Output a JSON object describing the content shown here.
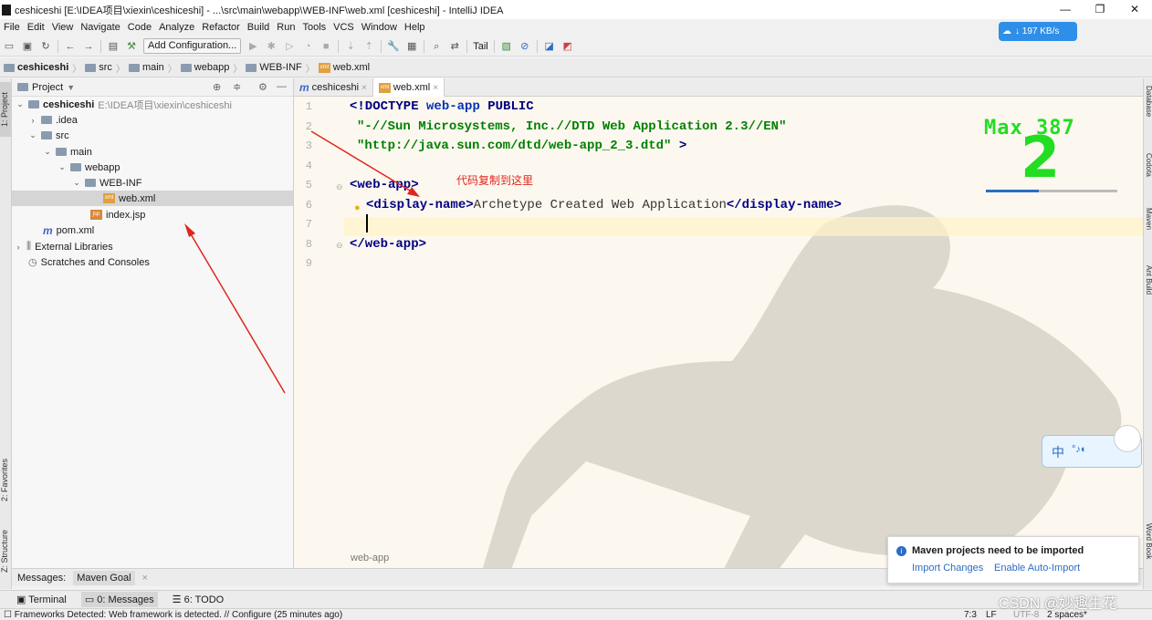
{
  "window": {
    "title": "ceshiceshi [E:\\IDEA项目\\xiexin\\ceshiceshi] - ...\\src\\main\\webapp\\WEB-INF\\web.xml [ceshiceshi] - IntelliJ IDEA",
    "minimize": "—",
    "maximize": "❐",
    "close": "✕"
  },
  "menu": [
    "File",
    "Edit",
    "View",
    "Navigate",
    "Code",
    "Analyze",
    "Refactor",
    "Build",
    "Run",
    "Tools",
    "VCS",
    "Window",
    "Help"
  ],
  "toolbar": {
    "add_configuration": "Add Configuration...",
    "tail": "Tail"
  },
  "breadcrumb": [
    "ceshiceshi",
    "src",
    "main",
    "webapp",
    "WEB-INF",
    "web.xml"
  ],
  "project_panel": {
    "title": "Project",
    "tree": [
      {
        "label": "ceshiceshi",
        "path": "E:\\IDEA项目\\xiexin\\ceshiceshi"
      },
      {
        "label": ".idea"
      },
      {
        "label": "src"
      },
      {
        "label": "main"
      },
      {
        "label": "webapp"
      },
      {
        "label": "WEB-INF"
      },
      {
        "label": "web.xml",
        "selected": true
      },
      {
        "label": "index.jsp"
      },
      {
        "label": "pom.xml"
      },
      {
        "label": "External Libraries"
      },
      {
        "label": "Scratches and Consoles"
      }
    ]
  },
  "editor": {
    "tabs": [
      {
        "label": "ceshiceshi",
        "close": "×"
      },
      {
        "label": "web.xml",
        "close": "×",
        "active": true
      }
    ],
    "line_numbers": [
      "1",
      "2",
      "3",
      "4",
      "5",
      "6",
      "7",
      "8",
      "9"
    ],
    "code": {
      "l1_a": "<!DOCTYPE",
      "l1_b": "web-app",
      "l1_c": "PUBLIC",
      "l2": "\"-//Sun Microsystems, Inc.//DTD Web Application 2.3//EN\"",
      "l3_a": "\"http://java.sun.com/dtd/web-app_2_3.dtd\"",
      "l3_b": ">",
      "l5_open": "<web-app>",
      "l6_tag_open": "<display-name>",
      "l6_text": "Archetype Created Web Application",
      "l6_tag_close": "</display-name>",
      "l8_close": "</web-app>"
    },
    "annotation": "代码复制到这里",
    "breadcrumb": "web-app"
  },
  "left_stripe": {
    "project": "1: Project",
    "favorites": "2: Favorites",
    "structure": "Z: Structure"
  },
  "right_stripe": [
    "Database",
    "Codota",
    "Maven",
    "Ant Build",
    "Word Book"
  ],
  "messages_bar": {
    "label": "Messages:",
    "tab": "Maven Goal",
    "close": "×"
  },
  "tool_windows": [
    "Terminal",
    "0: Messages",
    "6: TODO"
  ],
  "status_bar": {
    "message": "Frameworks Detected: Web framework is detected. // Configure (25 minutes ago)",
    "position": "7:3",
    "line_sep": "LF",
    "encoding": "UTF-8",
    "indent": "2 spaces*"
  },
  "notification": {
    "title": "Maven projects need to be imported",
    "import_changes": "Import Changes",
    "enable_auto_import": "Enable Auto-Import"
  },
  "overlays": {
    "speed": "↓ 197 KB/s",
    "max_label": "Max 387",
    "big_number": "2",
    "ime": "中",
    "watermark": "CSDN @妙趣生花"
  },
  "colors": {
    "annotation": "#e0261e",
    "link": "#2b6cc4",
    "keyword": "#000080",
    "string": "#008000"
  }
}
